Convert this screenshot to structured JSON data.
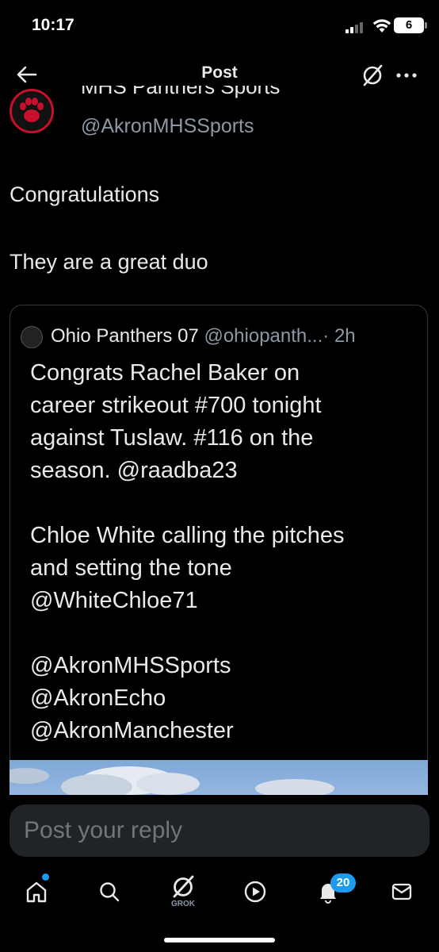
{
  "status_bar": {
    "time": "10:17",
    "battery": "6"
  },
  "nav": {
    "title": "Post"
  },
  "author": {
    "name": "MHS Panthers Sports",
    "handle": "@AkronMHSSports"
  },
  "post": {
    "lines": [
      "Congratulations",
      "They are a great duo"
    ]
  },
  "quote": {
    "name": "Ohio Panthers 07",
    "handle": "@ohiopanth...",
    "time": "· 2h",
    "text": "Congrats Rachel Baker on\ncareer strikeout #700 tonight\nagainst Tuslaw. #116 on the\nseason. @raadba23\n\nChloe White calling the pitches\nand setting the tone\n@WhiteChloe71\n\n@AkronMHSSports\n@AkronEcho\n@AkronManchester"
  },
  "reply": {
    "placeholder": "Post your reply"
  },
  "tabbar": {
    "grok_label": "GROK",
    "notifications_badge": "20"
  },
  "colors": {
    "background": "#000000",
    "text": "#e7e9ea",
    "secondary": "#8b98a5",
    "accent": "#1d9bf0",
    "avatar_ring": "#c8102e"
  }
}
